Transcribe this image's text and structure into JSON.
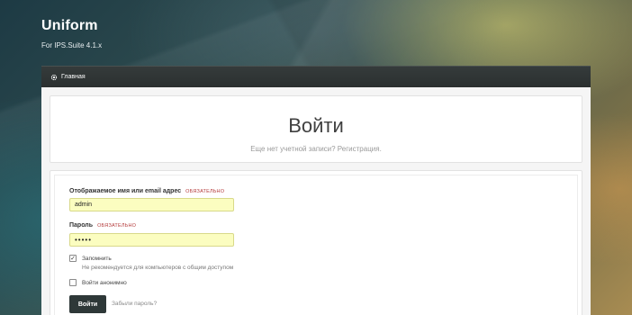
{
  "brand": {
    "title": "Uniform",
    "subtitle": "For IPS.Suite 4.1.x"
  },
  "navbar": {
    "home_label": "Главная",
    "home_icon": "gear-icon"
  },
  "login_header": {
    "title": "Войти",
    "hint": "Еще нет учетной записи? Регистрация."
  },
  "form": {
    "username": {
      "label": "Отображаемое имя или email адрес",
      "required": "ОБЯЗАТЕЛЬНО",
      "value": "admin"
    },
    "password": {
      "label": "Пароль",
      "required": "ОБЯЗАТЕЛЬНО",
      "value": "•••••"
    },
    "remember": {
      "label": "Запомнить",
      "description": "Не рекомендуется для компьютеров с общим доступом",
      "checked": true
    },
    "anonymous": {
      "label": "Войти анонимно",
      "checked": false
    },
    "submit_label": "Войти",
    "forgot_label": "Забыли пароль?"
  },
  "colors": {
    "navbar": "#2b3030",
    "input_autofill": "#fbfdc0",
    "required": "#b53b3b",
    "button": "#2e3838"
  }
}
